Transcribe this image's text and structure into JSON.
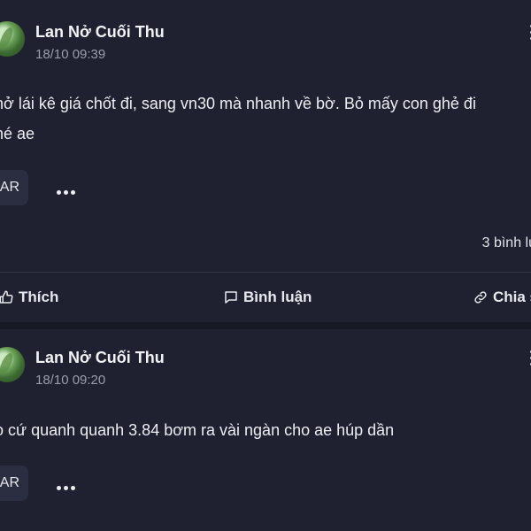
{
  "posts": [
    {
      "author": "Lan Nở Cuối Thu",
      "time": "18/10 09:39",
      "content_line1": "hở lái kê giá chốt đi, sang vn30 mà nhanh về bờ. Bỏ mấy con ghẻ đi",
      "content_line2": "hé ae",
      "tag": "AR",
      "comment_count": "3 bình lu",
      "actions": {
        "like": "Thích",
        "comment": "Bình luận",
        "share": "Chia s"
      }
    },
    {
      "author": "Lan Nở Cuối Thu",
      "time": "18/10 09:20",
      "content_line1": "o cứ quanh quanh 3.84 bơm ra vài ngàn cho ae húp dần",
      "tag": "AR"
    }
  ],
  "icons": [
    "avatar",
    "more-horizontal-icon",
    "more-vertical-icon",
    "thumbs-up-icon",
    "comment-icon",
    "link-icon"
  ],
  "colors": {
    "background": "#1f2130",
    "separator": "#171923",
    "text": "#eceef3",
    "muted": "#9a9cab",
    "chip": "#2b2e40"
  }
}
